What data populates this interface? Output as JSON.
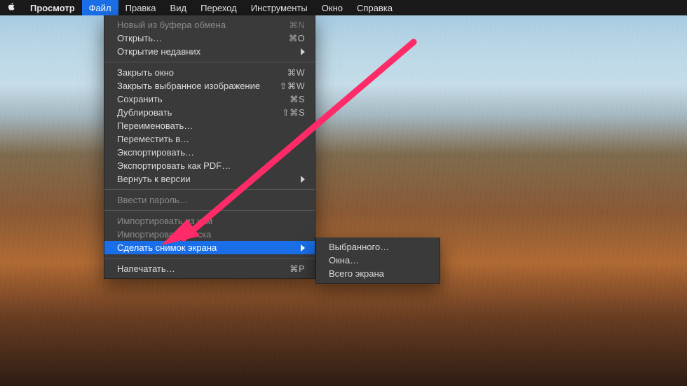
{
  "menubar": {
    "appname": "Просмотр",
    "items": [
      "Файл",
      "Правка",
      "Вид",
      "Переход",
      "Инструменты",
      "Окно",
      "Справка"
    ],
    "open_index": 0
  },
  "menu": {
    "groups": [
      [
        {
          "label": "Новый из буфера обмена",
          "shortcut": "⌘N",
          "disabled": true
        },
        {
          "label": "Открыть…",
          "shortcut": "⌘O"
        },
        {
          "label": "Открытие недавних",
          "submenu": true
        }
      ],
      [
        {
          "label": "Закрыть окно",
          "shortcut": "⌘W"
        },
        {
          "label": "Закрыть выбранное изображение",
          "shortcut": "⇧⌘W"
        },
        {
          "label": "Сохранить",
          "shortcut": "⌘S"
        },
        {
          "label": "Дублировать",
          "shortcut": "⇧⌘S"
        },
        {
          "label": "Переименовать…"
        },
        {
          "label": "Переместить в…"
        },
        {
          "label": "Экспортировать…"
        },
        {
          "label": "Экспортировать как PDF…"
        },
        {
          "label": "Вернуть к версии",
          "submenu": true
        }
      ],
      [
        {
          "label": "Ввести пароль…",
          "disabled": true
        }
      ],
      [
        {
          "label": "Импортировать из кам",
          "disabled": true
        },
        {
          "label": "Импортировать со ска",
          "disabled": true
        },
        {
          "label": "Сделать снимок экрана",
          "submenu": true,
          "highlight": true
        }
      ],
      [
        {
          "label": "Напечатать…",
          "shortcut": "⌘P"
        }
      ]
    ]
  },
  "submenu": {
    "items": [
      {
        "label": "Выбранного…"
      },
      {
        "label": "Окна…"
      },
      {
        "label": "Всего экрана"
      }
    ]
  },
  "annotation": {
    "color": "#ff2a68"
  }
}
